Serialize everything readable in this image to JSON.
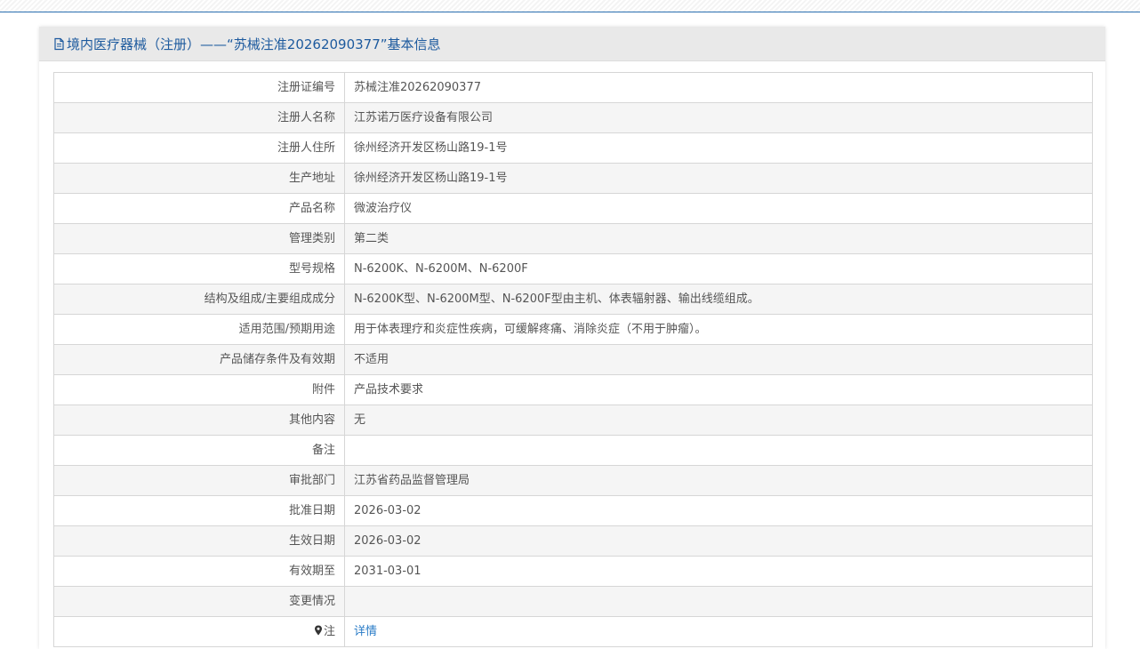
{
  "header": {
    "title": "境内医疗器械（注册）——“苏械注准20262090377”基本信息",
    "icon": "document-icon"
  },
  "rows": [
    {
      "label": "注册证编号",
      "value": "苏械注准20262090377"
    },
    {
      "label": "注册人名称",
      "value": "江苏诺万医疗设备有限公司"
    },
    {
      "label": "注册人住所",
      "value": "徐州经济开发区杨山路19-1号"
    },
    {
      "label": "生产地址",
      "value": "徐州经济开发区杨山路19-1号"
    },
    {
      "label": "产品名称",
      "value": "微波治疗仪"
    },
    {
      "label": "管理类别",
      "value": "第二类"
    },
    {
      "label": "型号规格",
      "value": "N-6200K、N-6200M、N-6200F"
    },
    {
      "label": "结构及组成/主要组成成分",
      "value": "N-6200K型、N-6200M型、N-6200F型由主机、体表辐射器、输出线缆组成。"
    },
    {
      "label": "适用范围/预期用途",
      "value": "用于体表理疗和炎症性疾病，可缓解疼痛、消除炎症（不用于肿瘤）。"
    },
    {
      "label": "产品储存条件及有效期",
      "value": "不适用"
    },
    {
      "label": "附件",
      "value": "产品技术要求"
    },
    {
      "label": "其他内容",
      "value": "无"
    },
    {
      "label": "备注",
      "value": ""
    },
    {
      "label": "审批部门",
      "value": "江苏省药品监督管理局"
    },
    {
      "label": "批准日期",
      "value": "2026-03-02"
    },
    {
      "label": "生效日期",
      "value": "2026-03-02"
    },
    {
      "label": "有效期至",
      "value": "2031-03-01"
    },
    {
      "label": "变更情况",
      "value": ""
    }
  ],
  "note": {
    "label": "注",
    "icon": "map-pin-icon",
    "link_text": "详情"
  },
  "colors": {
    "accent": "#1d5a9e",
    "link": "#2a7cc7",
    "row_alt": "#f5f5f5",
    "border": "#d6d6d6"
  }
}
